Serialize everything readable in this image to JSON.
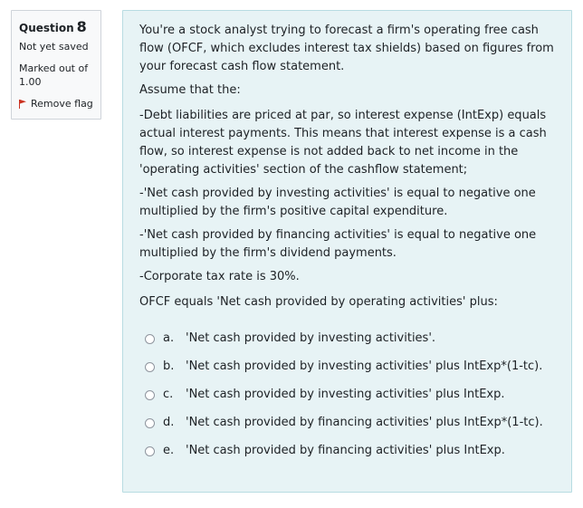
{
  "info": {
    "question_label": "Question",
    "question_number": "8",
    "state": "Not yet saved",
    "grade": "Marked out of 1.00",
    "flag_label": "Remove flag",
    "flag_color": "#ca3120"
  },
  "question": {
    "paragraphs": [
      "You're a stock analyst trying to forecast a firm's operating free cash flow (OFCF, which excludes interest tax shields) based on figures from your forecast cash flow statement.",
      "Assume that the:",
      "-Debt liabilities are priced at par, so interest expense (IntExp) equals actual interest payments. This means that interest expense is a cash flow, so interest expense is not added back to net income in the 'operating activities' section of the cashflow statement;",
      "-'Net cash provided by investing activities' is equal to negative one multiplied by the firm's positive capital expenditure.",
      "-'Net cash provided by financing activities' is equal to negative one multiplied by the firm's dividend payments.",
      "-Corporate tax rate is 30%.",
      "OFCF equals 'Net cash provided by operating activities' plus:"
    ],
    "answers": [
      {
        "letter": "a.",
        "text": "'Net cash provided by investing activities'."
      },
      {
        "letter": "b.",
        "text": "'Net cash provided by investing activities' plus IntExp*(1-tc)."
      },
      {
        "letter": "c.",
        "text": "'Net cash provided by investing activities' plus IntExp."
      },
      {
        "letter": "d.",
        "text": "'Net cash provided by financing activities' plus IntExp*(1-tc)."
      },
      {
        "letter": "e.",
        "text": "'Net cash provided by financing activities' plus IntExp."
      }
    ]
  },
  "colors": {
    "info_bg": "#f8f9fa",
    "content_bg": "#e7f3f5",
    "content_border": "#b8dce2"
  }
}
